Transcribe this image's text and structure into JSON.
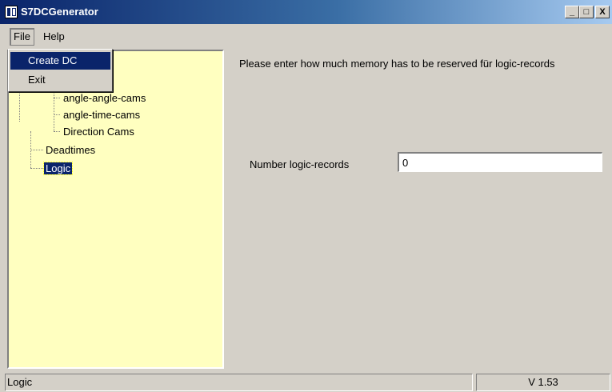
{
  "window": {
    "title": "S7DCGenerator",
    "controls": {
      "minimize": "_",
      "maximize": "□",
      "close": "X"
    }
  },
  "menubar": {
    "file": "File",
    "help": "Help"
  },
  "file_menu": {
    "items": [
      "Create DC",
      "Exit"
    ]
  },
  "tree": {
    "items": [
      {
        "label": "angle-angle-cams",
        "level": 2
      },
      {
        "label": "angle-time-cams",
        "level": 2
      },
      {
        "label": "Direction Cams",
        "level": 2
      },
      {
        "label": "Deadtimes",
        "level": 1
      },
      {
        "label": "Logic",
        "level": 1,
        "selected": true
      }
    ]
  },
  "content": {
    "prompt": "Please enter how much memory has to be reserved für logic-records",
    "field_label": "Number logic-records",
    "field_value": "0"
  },
  "statusbar": {
    "left": "Logic",
    "right": "V 1.53"
  },
  "colors": {
    "title_start": "#0a246a",
    "title_end": "#a6caf0",
    "tree_bg": "#ffffc0",
    "selection": "#0a246a",
    "window_bg": "#d4d0c8"
  }
}
